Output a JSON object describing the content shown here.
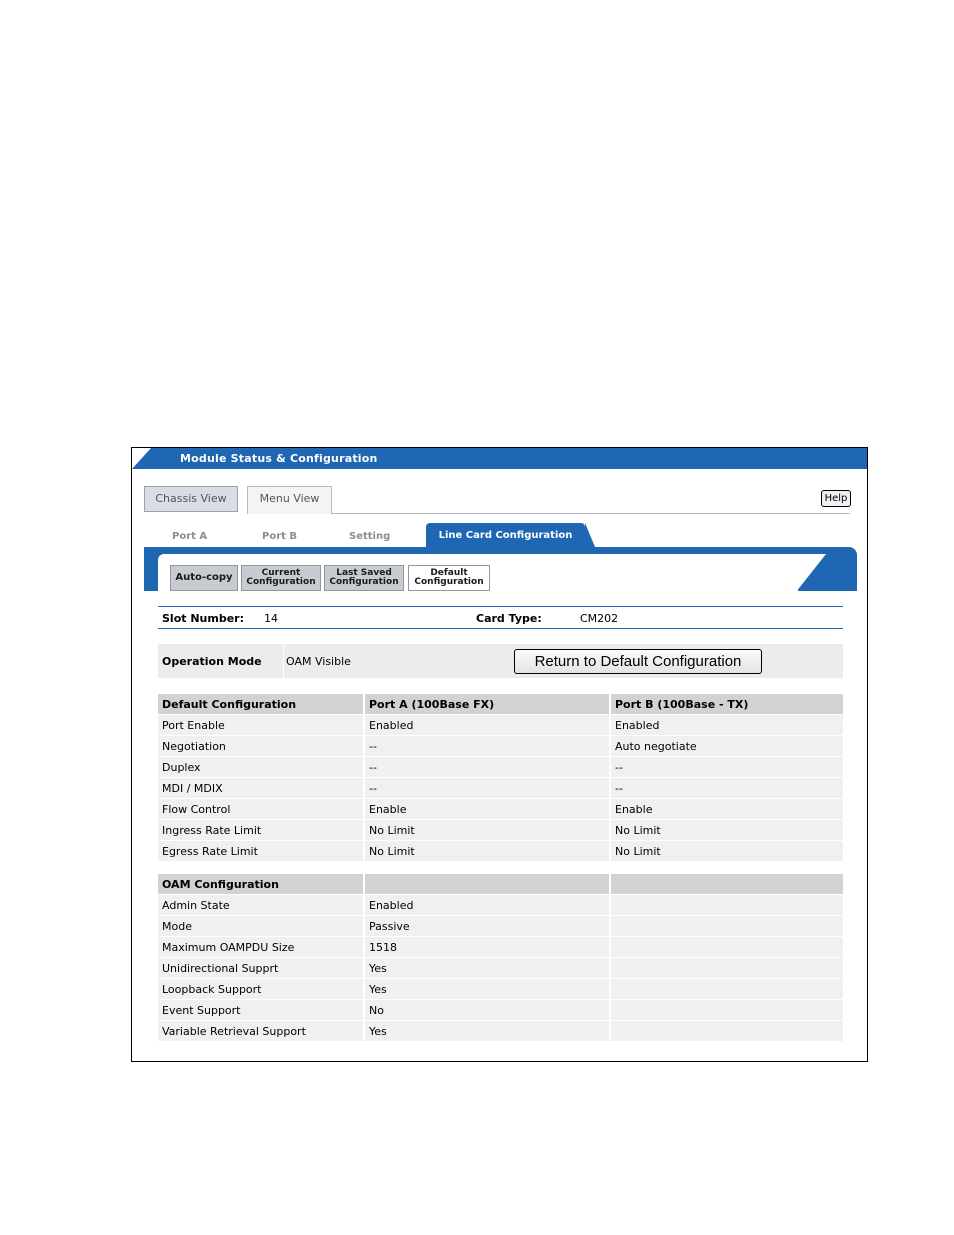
{
  "window": {
    "title": "Module Status & Configuration"
  },
  "view_tabs": {
    "chassis": "Chassis View",
    "menu": "Menu View"
  },
  "help_label": "Help",
  "sub_tabs": [
    "Port A",
    "Port B",
    "Setting",
    "Line Card Configuration"
  ],
  "buttons": {
    "auto_copy": "Auto-copy",
    "current": [
      "Current",
      "Configuration"
    ],
    "last_saved": [
      "Last Saved",
      "Configuration"
    ],
    "default": [
      "Default",
      "Configuration"
    ]
  },
  "slot": {
    "label": "Slot Number:",
    "value": "14"
  },
  "card": {
    "label": "Card Type:",
    "value": "CM202"
  },
  "operation": {
    "label": "Operation Mode",
    "value": "OAM Visible"
  },
  "return_button": "Return to Default Configuration",
  "default_table": {
    "headers": [
      "Default Configuration",
      "Port A (100Base FX)",
      "Port B (100Base - TX)"
    ],
    "rows": [
      [
        "Port Enable",
        "Enabled",
        "Enabled"
      ],
      [
        "Negotiation",
        "--",
        "Auto negotiate"
      ],
      [
        "Duplex",
        "--",
        "--"
      ],
      [
        "MDI / MDIX",
        "--",
        "--"
      ],
      [
        "Flow Control",
        "Enable",
        "Enable"
      ],
      [
        "Ingress Rate Limit",
        "No Limit",
        "No Limit"
      ],
      [
        "Egress Rate Limit",
        "No Limit",
        "No Limit"
      ]
    ]
  },
  "oam_table": {
    "header": "OAM Configuration",
    "rows": [
      [
        "Admin State",
        "Enabled"
      ],
      [
        "Mode",
        "Passive"
      ],
      [
        "Maximum OAMPDU Size",
        "1518"
      ],
      [
        "Unidirectional Supprt",
        "Yes"
      ],
      [
        "Loopback Support",
        "Yes"
      ],
      [
        "Event Support",
        "No"
      ],
      [
        "Variable Retrieval Support",
        "Yes"
      ]
    ]
  }
}
